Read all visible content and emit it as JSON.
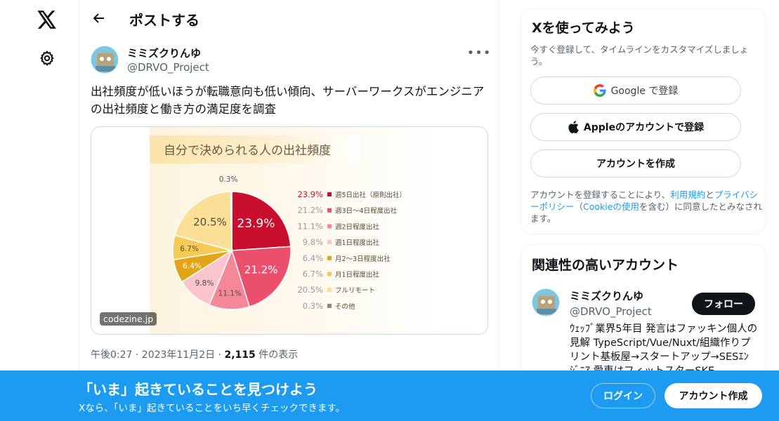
{
  "nav": {
    "logo_icon": "x-logo-icon",
    "settings_icon": "gear-icon"
  },
  "header": {
    "title": "ポストする"
  },
  "post": {
    "author_name": "ミミズクりんゆ",
    "author_handle": "@DRVO_Project",
    "text": "出社頻度が低いほうが転職意向も低い傾向、サーバーワークスがエンジニアの出社頻度と働き方の満足度を調査",
    "meta_time": "午後0:27 · 2023年11月2日 · ",
    "meta_views_count": "2,115",
    "meta_views_label": " 件の表示",
    "media": {
      "watermark": "codezine.jp",
      "chart_data": {
        "type": "pie",
        "title": "自分で決められる人の出社頻度",
        "slices": [
          {
            "label": "週5日出社（原則出社）",
            "value": 23.9,
            "value_label": "23.9%",
            "color": "#c8102e"
          },
          {
            "label": "週3日〜4日程度出社",
            "value": 21.2,
            "value_label": "21.2%",
            "color": "#ec4f6c"
          },
          {
            "label": "週2日程度出社",
            "value": 11.1,
            "value_label": "11.1%",
            "color": "#f5879b"
          },
          {
            "label": "週1日程度出社",
            "value": 9.8,
            "value_label": "9.8%",
            "color": "#f9c4cc"
          },
          {
            "label": "月2〜3日程度出社",
            "value": 6.4,
            "value_label": "6.4%",
            "color": "#e3a417"
          },
          {
            "label": "月1日程度出社",
            "value": 6.7,
            "value_label": "6.7%",
            "color": "#f6cb55"
          },
          {
            "label": "フルリモート",
            "value": 20.5,
            "value_label": "20.5%",
            "color": "#fbdf97"
          },
          {
            "label": "その他",
            "value": 0.3,
            "value_label": "0.3%",
            "color": "#888888"
          }
        ],
        "legend_position": "right"
      }
    }
  },
  "sidebar": {
    "signup_card": {
      "title": "Xを使ってみよう",
      "subtitle": "今すぐ登録して、タイムラインをカスタマイズしましょう。",
      "google_button": "Google で登録",
      "apple_button": "Appleのアカウントで登録",
      "create_button": "アカウントを作成",
      "terms_prefix": "アカウントを登録することにより、",
      "terms_link": "利用規約",
      "terms_and": "と",
      "privacy_link": "プライバシーポリシー",
      "terms_paren_open": "（",
      "cookie_link": "Cookieの使用",
      "terms_suffix": "を含む）に同意したとみなされます。"
    },
    "related_card": {
      "title": "関連性の高いアカウント",
      "name": "ミミズクりんゆ",
      "handle": "@DRVO_Project",
      "follow_button": "フォロー",
      "bio": "ｳｪｯﾌﾞ業界5年目 発言はファッキン個人の見解 TypeScript/Vue/Nuxt/組織作りプリント基板屋→スタートアップ→SESｴﾝｼﾞﾆｱ 愛車はフィットスターSKE"
    }
  },
  "banner": {
    "title": "「いま」起きていることを見つけよう",
    "subtitle": "Xなら、「いま」起きていることをいち早くチェックできます。",
    "login_button": "ログイン",
    "signup_button": "アカウント作成"
  }
}
